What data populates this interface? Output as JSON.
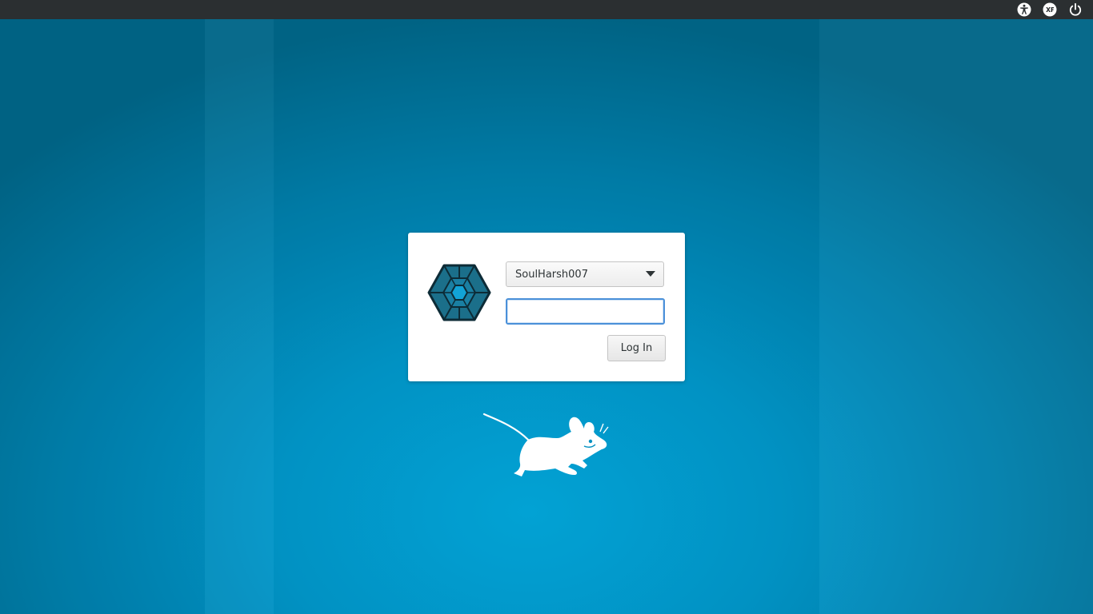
{
  "topbar": {
    "indicators": [
      {
        "icon": "accessibility-icon"
      },
      {
        "icon": "xfce-icon"
      },
      {
        "icon": "power-icon"
      }
    ]
  },
  "login": {
    "selected_user": "SoulHarsh007",
    "password_value": "",
    "login_button_label": "Log In"
  },
  "colors": {
    "topbar_bg": "#2b2f31",
    "background_center": "#03a6da",
    "background_edge": "#016688",
    "focus_ring": "#4a90d9",
    "avatar_fill": "#1b6f8a",
    "avatar_inner": "#12a3d6",
    "avatar_outline": "#0d2b36"
  }
}
